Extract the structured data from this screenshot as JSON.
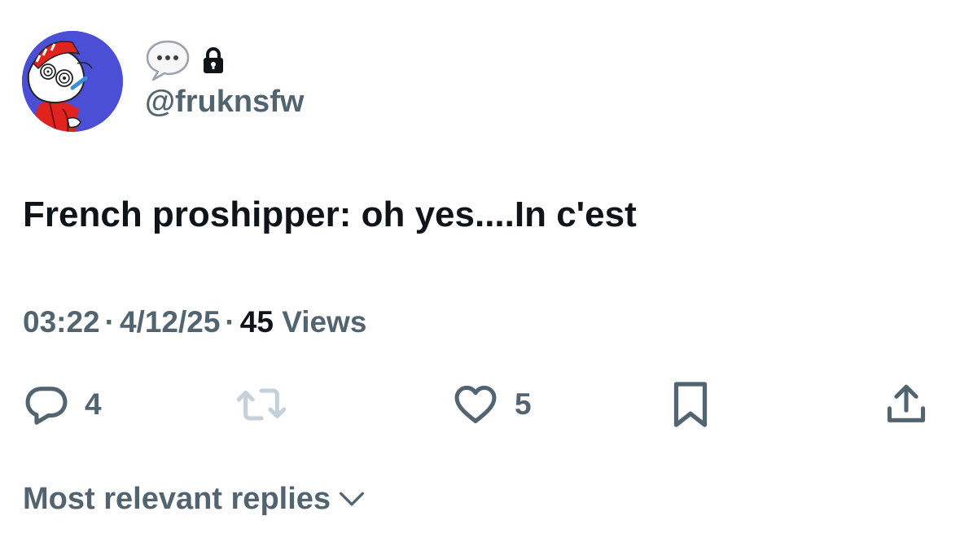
{
  "author": {
    "handle": "@fruknsfw",
    "name_emoji_icon": "speech-bubble-ellipsis-icon",
    "protected_icon": "lock-icon",
    "avatar": "cartoon-avatar"
  },
  "tweet": {
    "text": "French proshipper: oh yes....In c'est",
    "time": "03:22",
    "date": "4/12/25",
    "separator": "·",
    "views_count": "45",
    "views_label": "Views"
  },
  "actions": {
    "reply_count": "4",
    "repost_count": "",
    "like_count": "5",
    "icons": [
      "reply-icon",
      "repost-icon",
      "like-icon",
      "bookmark-icon",
      "share-icon"
    ]
  },
  "replies": {
    "sort_label": "Most relevant replies"
  },
  "colors": {
    "primary_text": "#0f1419",
    "secondary_text": "#536471",
    "repost_disabled": "#c5d1da",
    "avatar_bg": "#4a4fd6"
  }
}
